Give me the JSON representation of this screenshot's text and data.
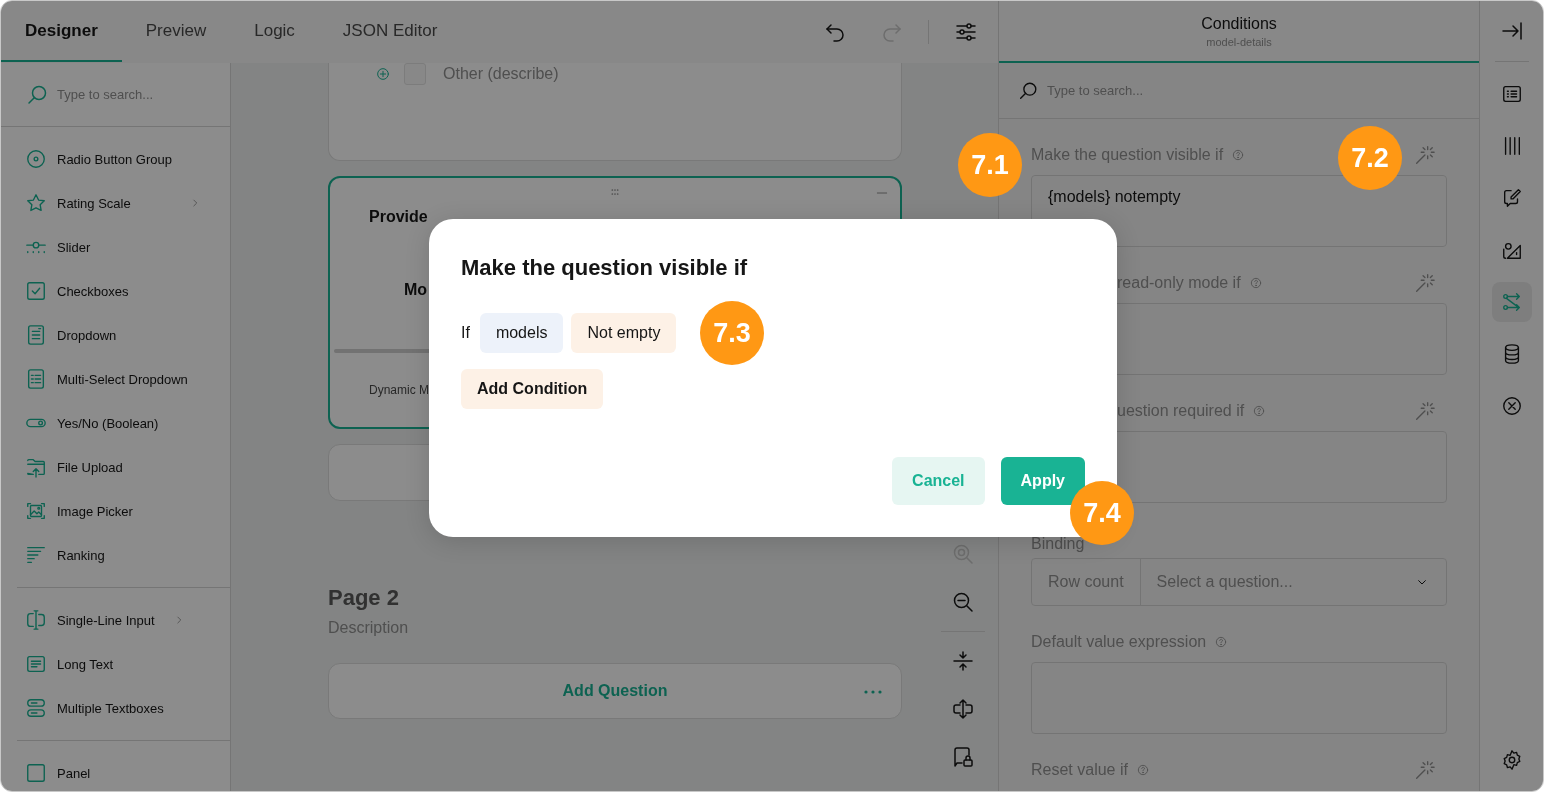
{
  "tabs": [
    {
      "label": "Designer",
      "selected": true
    },
    {
      "label": "Preview",
      "selected": false
    },
    {
      "label": "Logic",
      "selected": false
    },
    {
      "label": "JSON Editor",
      "selected": false
    }
  ],
  "toolbar": [
    {
      "kind": "undo",
      "disabled": false
    },
    {
      "kind": "redo",
      "disabled": true
    },
    {
      "kind": "settings",
      "disabled": false
    }
  ],
  "toolbox": {
    "search_placeholder": "Type to search...",
    "groups": [
      {
        "items": [
          {
            "label": "Radio Button Group",
            "submenu": false
          },
          {
            "label": "Rating Scale",
            "submenu": true
          },
          {
            "label": "Slider",
            "submenu": false
          },
          {
            "label": "Checkboxes",
            "submenu": false
          },
          {
            "label": "Dropdown",
            "submenu": false
          },
          {
            "label": "Multi-Select Dropdown",
            "submenu": false
          },
          {
            "label": "Yes/No (Boolean)",
            "submenu": false
          },
          {
            "label": "File Upload",
            "submenu": false
          },
          {
            "label": "Image Picker",
            "submenu": false
          },
          {
            "label": "Ranking",
            "submenu": false
          }
        ]
      },
      {
        "items": [
          {
            "label": "Single-Line Input",
            "submenu": true
          },
          {
            "label": "Long Text",
            "submenu": false
          },
          {
            "label": "Multiple Textboxes",
            "submenu": false
          }
        ]
      },
      {
        "items": [
          {
            "label": "Panel",
            "submenu": false
          }
        ]
      }
    ]
  },
  "canvas": {
    "other_option": {
      "label": "Other (describe)",
      "checked": false
    },
    "question": {
      "title": "Provide",
      "row_label": "Mo",
      "footer": "Dynamic M",
      "selected": true
    },
    "page": {
      "title": "Page 2",
      "description": "Description",
      "add_question": "Add Question"
    },
    "zoom_tools": [
      {
        "kind": "zoom-in",
        "disabled": true
      },
      {
        "kind": "zoom-out",
        "disabled": false
      }
    ],
    "layout_tools": [
      {
        "kind": "collapse",
        "disabled": false
      },
      {
        "kind": "expand",
        "disabled": false
      },
      {
        "kind": "lock",
        "disabled": false
      }
    ]
  },
  "property_panel": {
    "title": "Conditions",
    "subtitle": "model-details",
    "search_placeholder": "Type to search...",
    "properties": [
      {
        "kind": "condition",
        "label": "Make the question visible if",
        "value": "{models} notempty"
      },
      {
        "kind": "condition",
        "label": "read-only mode if",
        "clipped": true
      },
      {
        "kind": "condition",
        "label": "uestion required if",
        "clipped": true
      },
      {
        "kind": "binding",
        "label": "Binding",
        "binding": "Row count",
        "placeholder": "Select a question..."
      },
      {
        "kind": "expression",
        "label": "Default value expression"
      },
      {
        "kind": "condition-heading",
        "label": "Reset value if"
      }
    ]
  },
  "side_icons": [
    {
      "kind": "general",
      "selected": false
    },
    {
      "kind": "columns",
      "selected": false
    },
    {
      "kind": "edit",
      "selected": false
    },
    {
      "kind": "layout",
      "selected": false
    },
    {
      "kind": "logic",
      "selected": true
    },
    {
      "kind": "data",
      "selected": false
    },
    {
      "kind": "clear",
      "selected": false
    }
  ],
  "modal": {
    "title": "Make the question visible if",
    "if_label": "If",
    "operand": "models",
    "operator": "Not empty",
    "add_condition": "Add Condition",
    "buttons": [
      {
        "label": "Cancel",
        "kind": "secondary"
      },
      {
        "label": "Apply",
        "kind": "primary"
      }
    ]
  },
  "annotations": [
    {
      "label": "7.1"
    },
    {
      "label": "7.2"
    },
    {
      "label": "7.3"
    },
    {
      "label": "7.4"
    }
  ]
}
